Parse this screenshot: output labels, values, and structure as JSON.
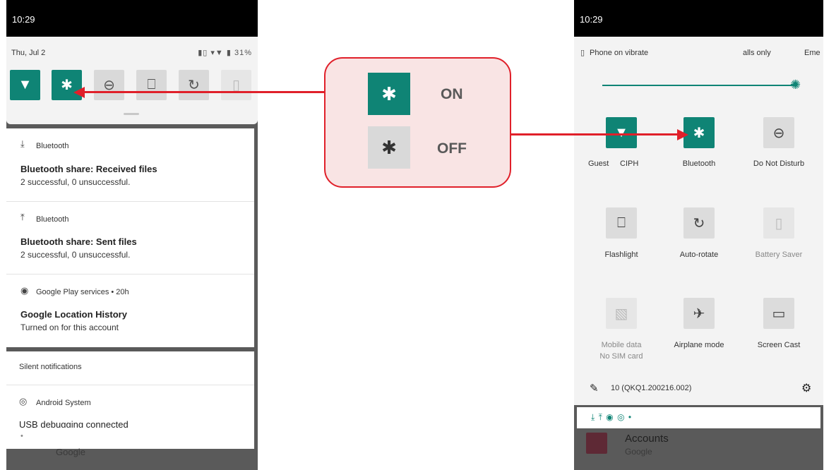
{
  "left_phone": {
    "time": "10:29",
    "date": "Thu, Jul 2",
    "status_icons": "▮▯ ▾▼ ▮ 31%",
    "battery": "31%",
    "tiles": [
      {
        "icon": "wifi-icon",
        "glyph": "▼",
        "state": "on"
      },
      {
        "icon": "bluetooth-icon",
        "glyph": "✱",
        "state": "on"
      },
      {
        "icon": "dnd-icon",
        "glyph": "⊖",
        "state": "off"
      },
      {
        "icon": "flashlight-icon",
        "glyph": "⎕",
        "state": "off"
      },
      {
        "icon": "auto-rotate-icon",
        "glyph": "↻",
        "state": "off"
      },
      {
        "icon": "battery-saver-icon",
        "glyph": "▯",
        "state": "dim"
      }
    ],
    "notifications": [
      {
        "app": "Bluetooth",
        "icon_glyph": "⤓",
        "title": "Bluetooth share: Received files",
        "text": "2 successful, 0 unsuccessful."
      },
      {
        "app": "Bluetooth",
        "icon_glyph": "⤒",
        "title": "Bluetooth share: Sent files",
        "text": "2 successful, 0 unsuccessful."
      },
      {
        "app": "Google Play services • 20h",
        "icon_glyph": "◉",
        "title": "Google Location History",
        "text": "Turned on for this account"
      }
    ],
    "section_header": "Silent notifications",
    "system_notification": {
      "app": "Android System",
      "title": "USB debugging connected"
    },
    "footer_dot": "•",
    "behind_text": "Google"
  },
  "callout": {
    "on_label": "ON",
    "off_label": "OFF",
    "on_color": "#0f8475",
    "off_color": "#d9d9d9"
  },
  "right_phone": {
    "time": "10:29",
    "header_left": "Phone on vibrate",
    "header_mid": "alls only",
    "header_right": "Eme",
    "brightness_level": 1.0,
    "tiles": [
      {
        "label": "CIPH",
        "label_prefix": "Guest",
        "glyph": "▼",
        "state": "on",
        "icon": "wifi-icon"
      },
      {
        "label": "Bluetooth",
        "glyph": "✱",
        "state": "on",
        "icon": "bluetooth-icon"
      },
      {
        "label": "Do Not Disturb",
        "glyph": "⊖",
        "state": "off",
        "icon": "dnd-icon"
      },
      {
        "label": "Flashlight",
        "glyph": "⎕",
        "state": "off",
        "icon": "flashlight-icon"
      },
      {
        "label": "Auto-rotate",
        "glyph": "↻",
        "state": "off",
        "icon": "auto-rotate-icon"
      },
      {
        "label": "Battery Saver",
        "glyph": "▯",
        "state": "dim",
        "icon": "battery-saver-icon"
      },
      {
        "label": "Mobile data",
        "sublabel": "No SIM card",
        "glyph": "▧",
        "state": "dim",
        "icon": "mobile-data-icon"
      },
      {
        "label": "Airplane mode",
        "glyph": "✈",
        "state": "off",
        "icon": "airplane-icon"
      },
      {
        "label": "Screen Cast",
        "glyph": "▭",
        "state": "off",
        "icon": "screen-cast-icon"
      }
    ],
    "build": "10 (QKQ1.200216.002)",
    "mini_icons": "⤓  ⤒  ◉  ◎  •",
    "behind_title": "Accounts",
    "behind_sub": "Google"
  }
}
